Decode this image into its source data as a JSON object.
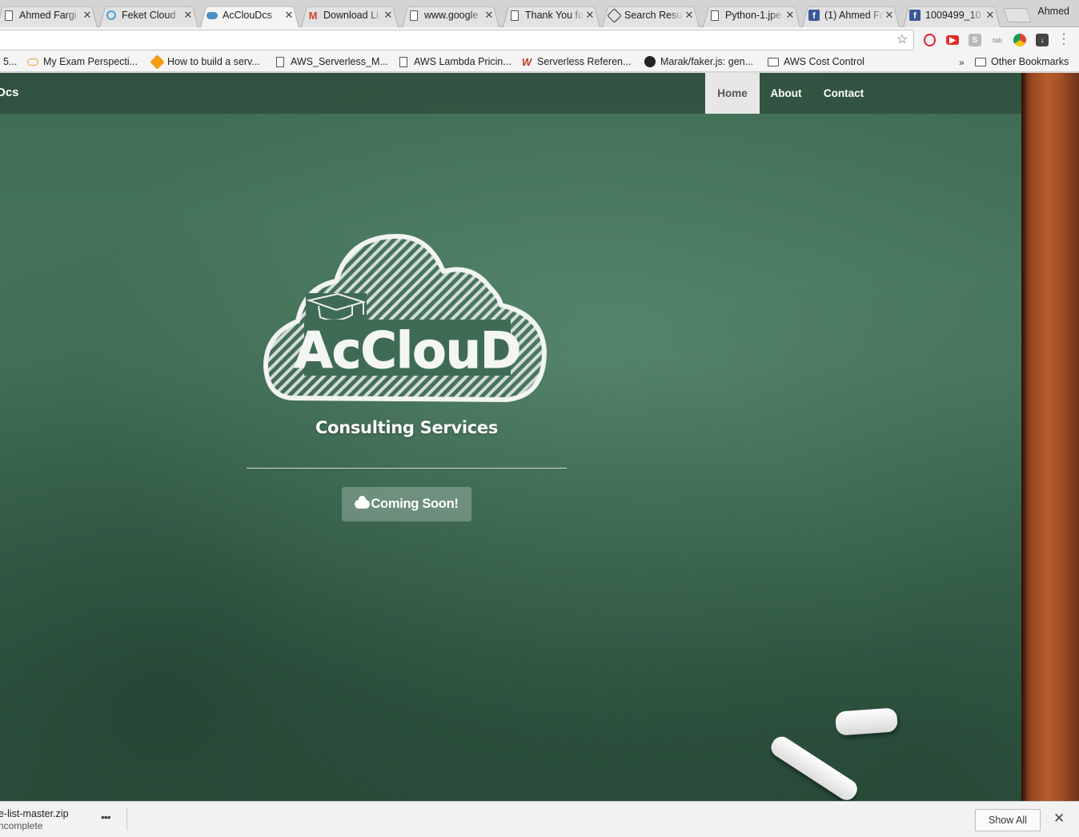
{
  "browser": {
    "tabs": [
      {
        "title": "Ahmed Fargi",
        "icon": "doc-icon",
        "active": false
      },
      {
        "title": "Feket Cloud",
        "icon": "feket-icon",
        "active": false
      },
      {
        "title": "AcClouDcs",
        "icon": "cloud-icon",
        "active": true
      },
      {
        "title": "Download Li",
        "icon": "gmail-icon",
        "active": false
      },
      {
        "title": "www.google",
        "icon": "doc-icon",
        "active": false
      },
      {
        "title": "Thank You fo",
        "icon": "doc-icon",
        "active": false
      },
      {
        "title": "Search Resu",
        "icon": "search-icon",
        "active": false
      },
      {
        "title": "Python-1.jpe",
        "icon": "doc-icon",
        "active": false
      },
      {
        "title": "(1) Ahmed Fa",
        "icon": "facebook-icon",
        "active": false
      },
      {
        "title": "1009499_10",
        "icon": "facebook-icon",
        "active": false
      }
    ],
    "profile_name": "Ahmed",
    "bookmarks": [
      {
        "label": "5...",
        "icon": ""
      },
      {
        "label": "My Exam Perspecti...",
        "icon": "cloud-icon"
      },
      {
        "label": "How to build a serv...",
        "icon": "cube-icon"
      },
      {
        "label": "AWS_Serverless_M...",
        "icon": "doc-icon"
      },
      {
        "label": "AWS Lambda Pricin...",
        "icon": "doc-icon"
      },
      {
        "label": "Serverless Referen...",
        "icon": "serverless-icon"
      },
      {
        "label": "Marak/faker.js: gen...",
        "icon": "github-icon"
      },
      {
        "label": "AWS Cost Control",
        "icon": "folder-icon"
      }
    ],
    "overflow_chevron": "»",
    "other_bookmarks": "Other Bookmarks"
  },
  "site": {
    "brand": "Dcs",
    "nav": [
      {
        "label": "Home",
        "active": true
      },
      {
        "label": "About",
        "active": false
      },
      {
        "label": "Contact",
        "active": false
      }
    ],
    "logo_text": "AcClouD",
    "tagline": "Consulting Services",
    "cta_label": "Coming Soon!"
  },
  "download_shelf": {
    "file_name": "e-list-master.zip",
    "status": "ncomplete",
    "more": "•••",
    "show_all": "Show All",
    "close": "✕"
  }
}
